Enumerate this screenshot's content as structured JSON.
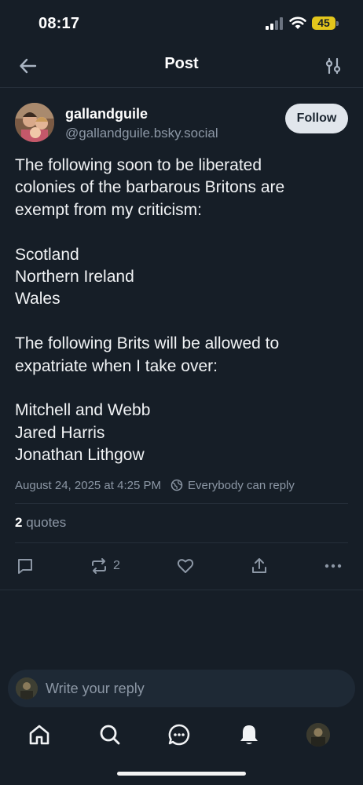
{
  "status_bar": {
    "time": "08:17",
    "battery": "45"
  },
  "header": {
    "title": "Post"
  },
  "post": {
    "author_name": "gallandguile",
    "author_handle": "@gallandguile.bsky.social",
    "follow_label": "Follow",
    "body_lines": [
      "The following soon to be liberated",
      "colonies of the barbarous Britons are",
      "exempt from my criticism:",
      "",
      "Scotland",
      "Northern Ireland",
      "Wales",
      "",
      "The following Brits will be allowed to",
      "expatriate when I take over:",
      "",
      "Mitchell and Webb",
      "Jared Harris",
      "Jonathan Lithgow"
    ],
    "timestamp": "August 24, 2025 at 4:25 PM",
    "reply_permission": "Everybody can reply",
    "quotes_count": "2",
    "quotes_label": "quotes",
    "repost_count": "2"
  },
  "reply": {
    "placeholder": "Write your reply"
  },
  "icons": {
    "back": "arrow-left-icon",
    "settings": "sliders-icon",
    "reply": "comment-icon",
    "repost": "repost-icon",
    "like": "heart-icon",
    "share": "share-icon",
    "more": "more-icon",
    "home": "home-icon",
    "search": "search-icon",
    "chat": "chat-icon",
    "notifications": "bell-icon",
    "globe": "globe-icon"
  },
  "colors": {
    "background": "#161e27",
    "muted_text": "#8c97a5",
    "battery": "#e3c61c",
    "follow_button": "#e1e6ec"
  }
}
